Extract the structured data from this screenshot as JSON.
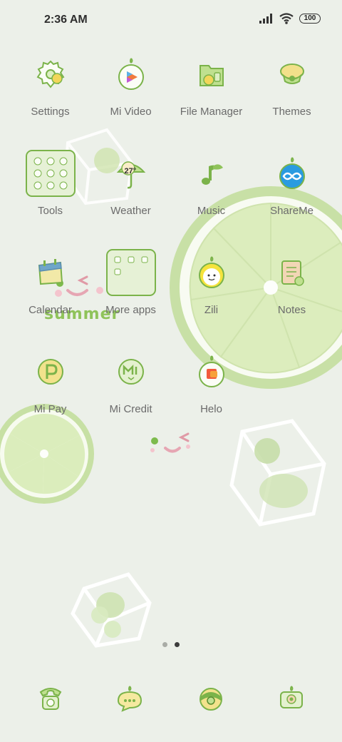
{
  "status_bar": {
    "time": "2:36 AM",
    "battery": "100",
    "icons": [
      "signal-icon",
      "wifi-icon",
      "battery-icon"
    ]
  },
  "wallpaper": {
    "decoration_text": "summer",
    "elements": [
      "lime-slice",
      "ice-cube",
      "smiley-face"
    ]
  },
  "apps": [
    {
      "label": "Settings",
      "icon": "settings-icon"
    },
    {
      "label": "Mi Video",
      "icon": "mi-video-icon"
    },
    {
      "label": "File Manager",
      "icon": "file-manager-icon"
    },
    {
      "label": "Themes",
      "icon": "themes-icon"
    },
    {
      "label": "Tools",
      "icon": "tools-folder-icon"
    },
    {
      "label": "Weather",
      "icon": "weather-icon",
      "badge": "27°"
    },
    {
      "label": "Music",
      "icon": "music-icon"
    },
    {
      "label": "ShareMe",
      "icon": "shareme-icon"
    },
    {
      "label": "Calendar",
      "icon": "calendar-icon"
    },
    {
      "label": "More apps",
      "icon": "more-apps-folder-icon"
    },
    {
      "label": "Zili",
      "icon": "zili-icon"
    },
    {
      "label": "Notes",
      "icon": "notes-icon"
    },
    {
      "label": "Mi Pay",
      "icon": "mi-pay-icon"
    },
    {
      "label": "Mi Credit",
      "icon": "mi-credit-icon"
    },
    {
      "label": "Helo",
      "icon": "helo-icon"
    }
  ],
  "page_indicator": {
    "pages": 2,
    "active": 2
  },
  "dock": [
    {
      "icon": "phone-icon"
    },
    {
      "icon": "messages-icon"
    },
    {
      "icon": "browser-icon"
    },
    {
      "icon": "camera-icon"
    }
  ],
  "colors": {
    "background": "#ecf0e9",
    "accent_green": "#7bb34a",
    "lime_light": "#dbeebb",
    "label_gray": "#6b6b6b"
  }
}
